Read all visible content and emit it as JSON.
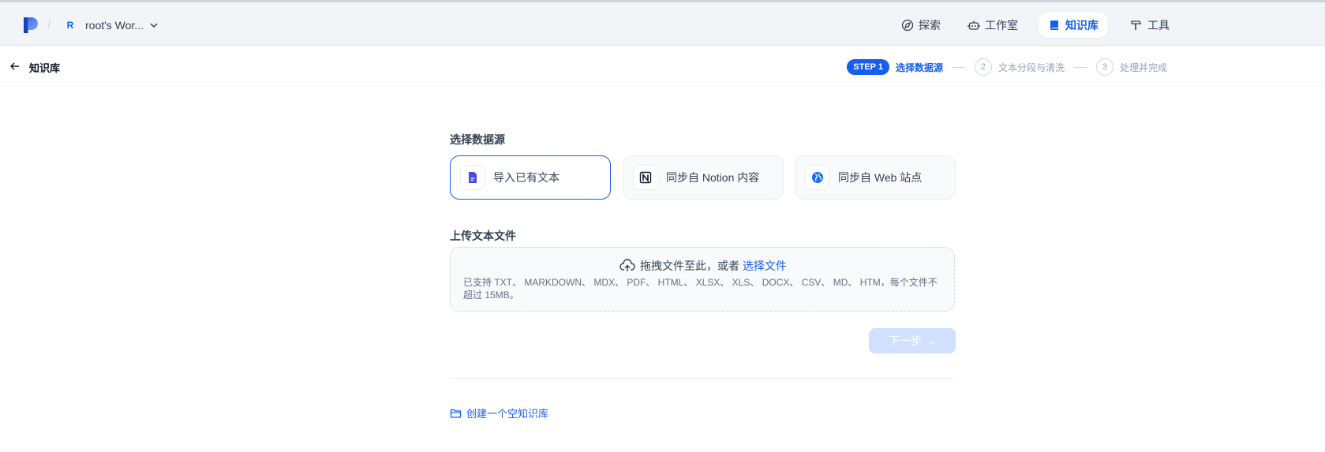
{
  "header": {
    "workspace_initial": "R",
    "workspace_name": "root's Wor...",
    "nav": [
      {
        "label": "探索",
        "icon": "compass-icon",
        "active": false
      },
      {
        "label": "工作室",
        "icon": "robot-icon",
        "active": false
      },
      {
        "label": "知识库",
        "icon": "book-icon",
        "active": true
      },
      {
        "label": "工具",
        "icon": "hammer-icon",
        "active": false
      }
    ]
  },
  "subheader": {
    "back_label": "知识库",
    "steps": {
      "current_badge": "STEP 1",
      "current_label": "选择数据源",
      "step2_num": "2",
      "step2_label": "文本分段与清洗",
      "step3_num": "3",
      "step3_label": "处理并完成"
    }
  },
  "main": {
    "source_title": "选择数据源",
    "sources": [
      {
        "label": "导入已有文本",
        "icon": "file-text-icon",
        "selected": true
      },
      {
        "label": "同步自 Notion 内容",
        "icon": "notion-icon",
        "selected": false
      },
      {
        "label": "同步自 Web 站点",
        "icon": "globe-icon",
        "selected": false
      }
    ],
    "upload_title": "上传文本文件",
    "drop_text": "拖拽文件至此，或者",
    "drop_link": "选择文件",
    "drop_tip": "已支持 TXT、 MARKDOWN、 MDX、 PDF、 HTML、 XLSX、 XLS、 DOCX、 CSV、 MD、 HTM，每个文件不超过 15MB。",
    "next_label": "下一步 →",
    "create_empty_label": "创建一个空知识库"
  },
  "colors": {
    "accent": "#155eef",
    "header_bg": "#f2f4f7",
    "next_disabled": "#d1e0ff"
  }
}
